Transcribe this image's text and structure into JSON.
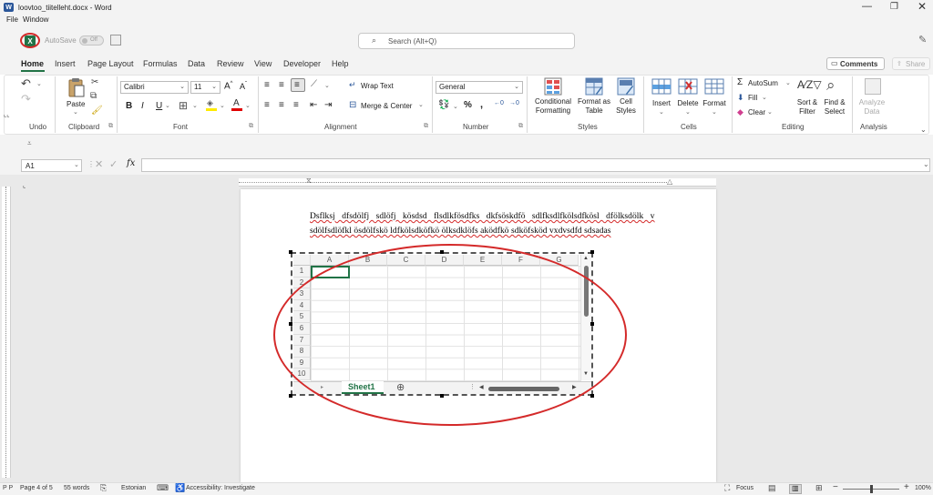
{
  "window": {
    "title": "loovtoo_tiitelleht.docx - Word",
    "menu": [
      "File",
      "Window"
    ]
  },
  "quickbar": {
    "autosave_label": "AutoSave",
    "toggle_label": "Off",
    "search_placeholder": "Search (Alt+Q)"
  },
  "tabs": [
    "Home",
    "Insert",
    "Page Layout",
    "Formulas",
    "Data",
    "Review",
    "View",
    "Developer",
    "Help"
  ],
  "active_tab": "Home",
  "comments_label": "Comments",
  "share_label": "Share",
  "ribbon": {
    "paste": "Paste",
    "font_name": "Calibri",
    "font_size": "11",
    "wrap_text": "Wrap Text",
    "merge_center": "Merge & Center",
    "number_format": "General",
    "conditional": "Conditional Formatting",
    "format_table": "Format as Table",
    "cell_styles": "Cell Styles",
    "insert": "Insert",
    "delete": "Delete",
    "format": "Format",
    "autosum": "AutoSum",
    "fill": "Fill",
    "clear": "Clear",
    "sort_filter": "Sort & Filter",
    "find_select": "Find & Select",
    "analyze_data": "Analyze Data",
    "groups": {
      "undo": "Undo",
      "clipboard": "Clipboard",
      "font": "Font",
      "alignment": "Alignment",
      "number": "Number",
      "styles": "Styles",
      "cells": "Cells",
      "editing": "Editing",
      "analysis": "Analysis"
    }
  },
  "formula_bar": {
    "name_box": "A1",
    "fx": "fx",
    "value": ""
  },
  "document": {
    "line1": "Dsflksj dfsdölfj sdlöfj kösdsd flsdlkfösdfks dkfsöskdfö sdlfksdlfkölsdfkösl dfölksdölk v",
    "line2": "sdölfsdlöfkl ösdölfskö ldfkölsdköfkö ölksdklöfs aködfkö sdköfsköd vxdvsdfd sdsadas"
  },
  "embedded_sheet": {
    "columns": [
      "A",
      "B",
      "C",
      "D",
      "E",
      "F",
      "G"
    ],
    "rows": [
      "1",
      "2",
      "3",
      "4",
      "5",
      "6",
      "7",
      "8",
      "9",
      "10"
    ],
    "sheet_tab": "Sheet1"
  },
  "status_bar": {
    "page": "Page 4 of 5",
    "words": "55 words",
    "language": "Estonian",
    "accessibility": "Accessibility: Investigate",
    "focus": "Focus",
    "zoom": "100%"
  },
  "colors": {
    "accent": "#217346",
    "annotation": "#d42a2a",
    "word_blue": "#2b579a"
  }
}
